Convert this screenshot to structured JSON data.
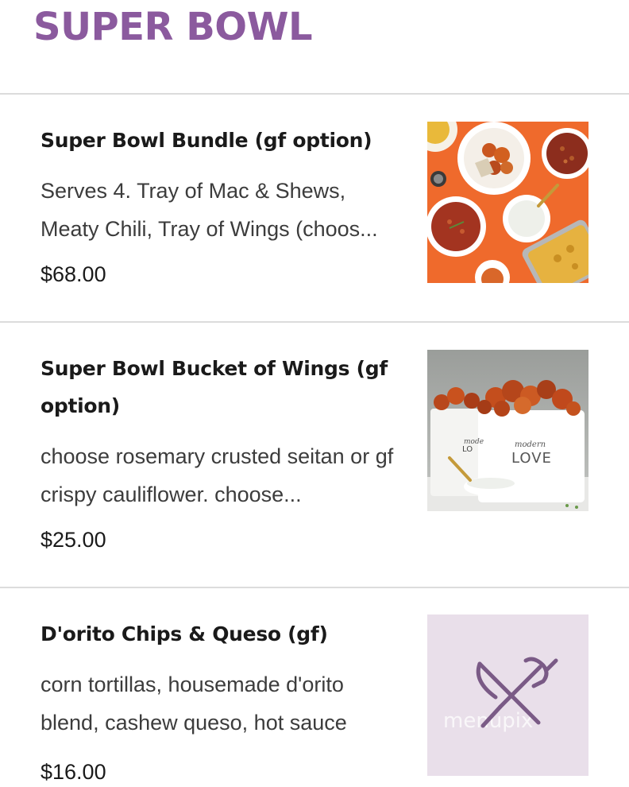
{
  "section": {
    "title": "SUPER BOWL"
  },
  "items": [
    {
      "name": "Super Bowl Bundle (gf option)",
      "description": "Serves 4. Tray of Mac & Shews, Meaty Chili, Tray of Wings (choos...",
      "price": "$68.00",
      "image": "food-spread-photo"
    },
    {
      "name": "Super Bowl Bucket of Wings (gf option)",
      "description": "choose rosemary crusted seitan or gf crispy cauliflower. choose...",
      "price": "$25.00",
      "image": "wings-bucket-photo",
      "image_text": {
        "bucket_left": "mode LO",
        "bucket_right_top": "modern",
        "bucket_right_bottom": "LOVE"
      }
    },
    {
      "name": "D'orito Chips & Queso (gf)",
      "description": "corn tortillas, housemade d'orito blend, cashew queso, hot sauce",
      "price": "$16.00",
      "image": "fork-knife-placeholder-icon",
      "image_text": {
        "watermark": "menupix"
      }
    }
  ],
  "colors": {
    "accent": "#8b5a9e",
    "divider": "#dcdcdc",
    "placeholder_bg": "#e9dfea",
    "placeholder_icon": "#7a5a86"
  }
}
